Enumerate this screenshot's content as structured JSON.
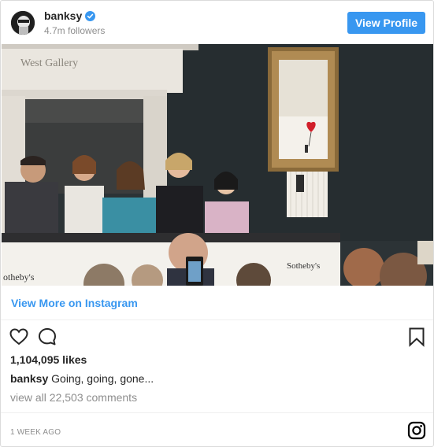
{
  "header": {
    "username": "banksy",
    "followers": "4.7m followers",
    "view_profile_label": "View Profile",
    "verified_color": "#3897f0"
  },
  "media": {
    "wall_sign": "West Gallery",
    "desk_text_left": "otheby's",
    "desk_text_right": "Sotheby's"
  },
  "link": {
    "label": "View More on Instagram"
  },
  "actions": {
    "icons": [
      "heart-icon",
      "comment-icon",
      "bookmark-icon"
    ]
  },
  "post": {
    "likes": "1,104,095 likes",
    "caption_user": "banksy",
    "caption_text": "Going, going, gone...",
    "comments_link": "view all 22,503 comments",
    "timestamp": "1 WEEK AGO"
  },
  "footer": {
    "icon": "instagram-logo-icon"
  },
  "colors": {
    "accent": "#3897f0",
    "text": "#262626",
    "muted": "#8e8e8e"
  }
}
